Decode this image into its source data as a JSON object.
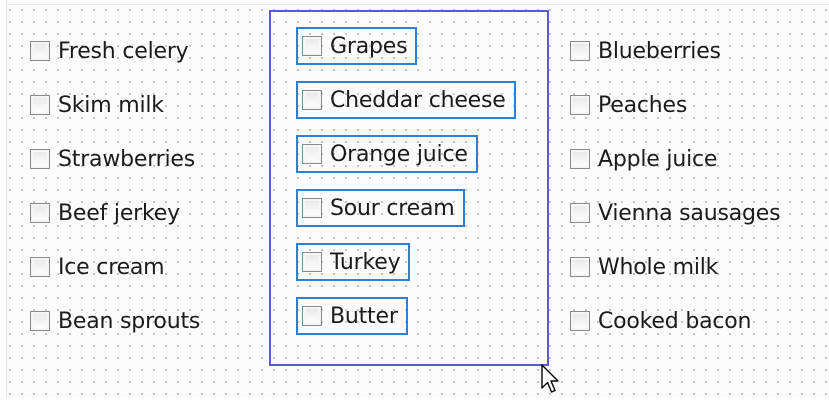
{
  "columns": [
    {
      "items": [
        {
          "label": "Fresh celery",
          "checked": false
        },
        {
          "label": "Skim milk",
          "checked": false
        },
        {
          "label": "Strawberries",
          "checked": false
        },
        {
          "label": "Beef jerkey",
          "checked": false
        },
        {
          "label": "Ice cream",
          "checked": false
        },
        {
          "label": "Bean sprouts",
          "checked": false
        }
      ]
    },
    {
      "selected": true,
      "items": [
        {
          "label": "Grapes",
          "checked": false
        },
        {
          "label": "Cheddar cheese",
          "checked": false
        },
        {
          "label": "Orange juice",
          "checked": false
        },
        {
          "label": "Sour cream",
          "checked": false
        },
        {
          "label": "Turkey",
          "checked": false
        },
        {
          "label": "Butter",
          "checked": false
        }
      ]
    },
    {
      "items": [
        {
          "label": "Blueberries",
          "checked": false
        },
        {
          "label": "Peaches",
          "checked": false
        },
        {
          "label": "Apple juice",
          "checked": false
        },
        {
          "label": "Vienna sausages",
          "checked": false
        },
        {
          "label": "Whole milk",
          "checked": false
        },
        {
          "label": "Cooked bacon",
          "checked": false
        }
      ]
    }
  ],
  "colors": {
    "selection_border": "#2f7fd6",
    "group_border": "#5b5bd0",
    "grid_dot": "#b9b9b9"
  },
  "cursor_icon": "arrow-pointer-icon"
}
